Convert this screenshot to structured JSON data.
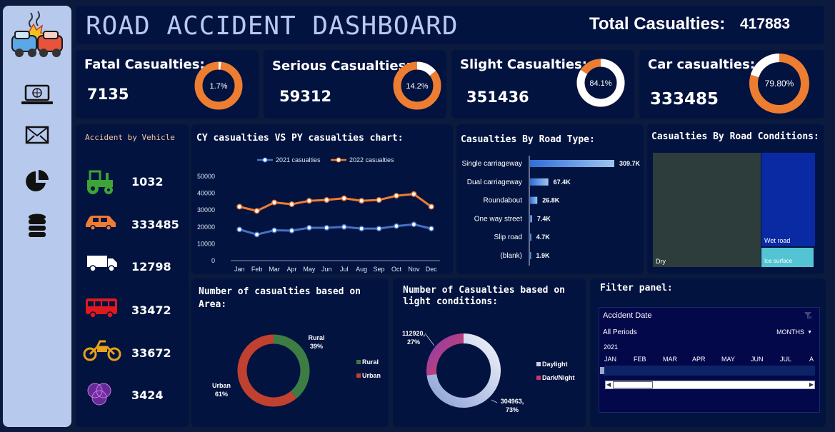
{
  "header": {
    "title": "ROAD ACCIDENT DASHBOARD",
    "total_label": "Total Casualties:",
    "total_value": "417883"
  },
  "sidebar": {
    "icons": [
      "crash-logo-icon",
      "laptop-icon",
      "mail-icon",
      "pie-icon",
      "database-icon"
    ]
  },
  "kpis": [
    {
      "label": "Fatal Casualties:",
      "value": "7135",
      "percent_text": "1.7%",
      "fraction": 0.017
    },
    {
      "label": "Serious Casualties:",
      "value": "59312",
      "percent_text": "14.2%",
      "fraction": 0.142
    },
    {
      "label": "Slight Casualties:",
      "value": "351436",
      "percent_text": "84.1%",
      "fraction": 0.841
    },
    {
      "label": "Car casualties:",
      "value": "333485",
      "percent_text": "79.80%",
      "fraction": 0.798
    }
  ],
  "vehicles": {
    "title": "Accident by Vehicle",
    "items": [
      {
        "icon": "tractor-icon",
        "value": "1032",
        "color": "#3ea43a"
      },
      {
        "icon": "car-icon",
        "value": "333485",
        "color": "#ee7d31"
      },
      {
        "icon": "truck-icon",
        "value": "12798",
        "color": "#ffffff"
      },
      {
        "icon": "bus-icon",
        "value": "33472",
        "color": "#e0191f"
      },
      {
        "icon": "motorcycle-icon",
        "value": "33672",
        "color": "#e8a118"
      },
      {
        "icon": "other-vehicle-icon",
        "value": "3424",
        "color": "#7a2fa8"
      }
    ]
  },
  "chart_data": [
    {
      "type": "line",
      "title": "CY casualties VS PY casualties chart:",
      "categories": [
        "Jan",
        "Feb",
        "Mar",
        "Apr",
        "May",
        "Jun",
        "Jul",
        "Aug",
        "Sep",
        "Oct",
        "Nov",
        "Dec"
      ],
      "series": [
        {
          "name": "2021 casualties",
          "color": "#4472c4",
          "values": [
            18500,
            15500,
            18000,
            17800,
            19500,
            19500,
            20000,
            19000,
            19000,
            20500,
            21500,
            19000
          ]
        },
        {
          "name": "2022 casualties",
          "color": "#ed7d31",
          "values": [
            32000,
            29500,
            34500,
            33500,
            35500,
            36000,
            37000,
            35500,
            36000,
            38500,
            39500,
            32000
          ]
        }
      ],
      "yticks": [
        "0",
        "10000",
        "20000",
        "30000",
        "40000",
        "50000"
      ],
      "ylim": [
        0,
        50000
      ]
    },
    {
      "type": "bar",
      "title": "Casualties By Road Type:",
      "categories": [
        "Single carriageway",
        "Dual carriageway",
        "Roundabout",
        "One way street",
        "Slip road",
        "(blank)"
      ],
      "values": [
        309700,
        67400,
        26800,
        7400,
        4700,
        1900
      ],
      "labels": [
        "309.7K",
        "67.4K",
        "26.8K",
        "7.4K",
        "4.7K",
        "1.9K"
      ]
    },
    {
      "type": "heatmap",
      "title": "Casualties By Road Conditions:",
      "categories": [
        "Dry",
        "Wet road",
        "Ice surface"
      ],
      "colors": [
        "#2d3d3b",
        "#0a2aa4",
        "#54c4d4"
      ]
    },
    {
      "type": "pie",
      "title": "Number of casualties based on Area:",
      "categories": [
        "Rural",
        "Urban"
      ],
      "values": [
        39,
        61
      ],
      "labels": [
        "Rural\n39%",
        "Urban\n61%"
      ],
      "colors": [
        "#3d7d44",
        "#c0412f"
      ]
    },
    {
      "type": "pie",
      "title": "Number of Casualties based on light conditions:",
      "categories": [
        "Daylight",
        "Dark/Night"
      ],
      "values": [
        304963,
        112920
      ],
      "labels": [
        "304963,\n73%",
        "112920,\n27%"
      ],
      "colors": [
        "#c9d2e6",
        "#c23a6a"
      ]
    }
  ],
  "filter": {
    "title": "Filter panel:",
    "header": "Accident Date",
    "period": "All Periods",
    "unit": "MONTHS",
    "year": "2021",
    "months": [
      "JAN",
      "FEB",
      "MAR",
      "APR",
      "MAY",
      "JUN",
      "JUL",
      "A"
    ]
  }
}
